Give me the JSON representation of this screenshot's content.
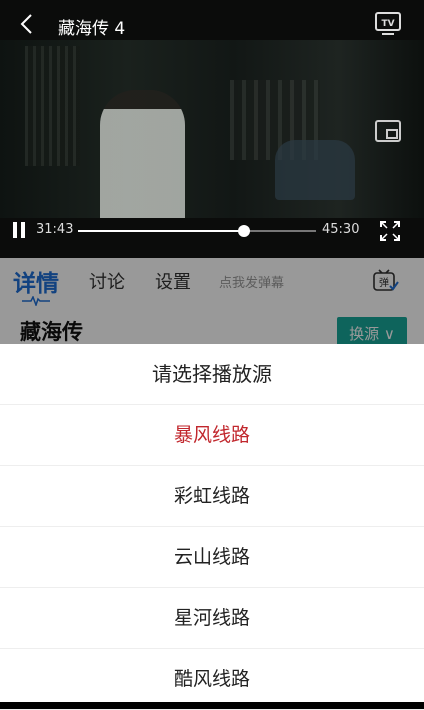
{
  "player": {
    "title": "藏海传 4",
    "current_time": "31:43",
    "duration": "45:30",
    "progress_fraction": 0.697
  },
  "tabs": {
    "items": [
      {
        "label": "详情",
        "active": true
      },
      {
        "label": "讨论",
        "active": false
      },
      {
        "label": "设置",
        "active": false
      }
    ],
    "danmu_placeholder": "点我发弹幕",
    "danmu_icon_label": "弹"
  },
  "detail": {
    "show_title": "藏海传",
    "switch_label": "换源 ∨"
  },
  "source_sheet": {
    "title": "请选择播放源",
    "options": [
      {
        "label": "暴风线路",
        "selected": true
      },
      {
        "label": "彩虹线路",
        "selected": false
      },
      {
        "label": "云山线路",
        "selected": false
      },
      {
        "label": "星河线路",
        "selected": false
      },
      {
        "label": "酷风线路",
        "selected": false
      }
    ]
  },
  "colors": {
    "accent_blue": "#1f6fd6",
    "switch_green": "#18a79a",
    "selected_red": "#c1272d"
  },
  "icons": [
    "back-icon",
    "tv-cast-icon",
    "pip-icon",
    "pause-icon",
    "fullscreen-icon",
    "danmu-icon",
    "wave-icon"
  ]
}
